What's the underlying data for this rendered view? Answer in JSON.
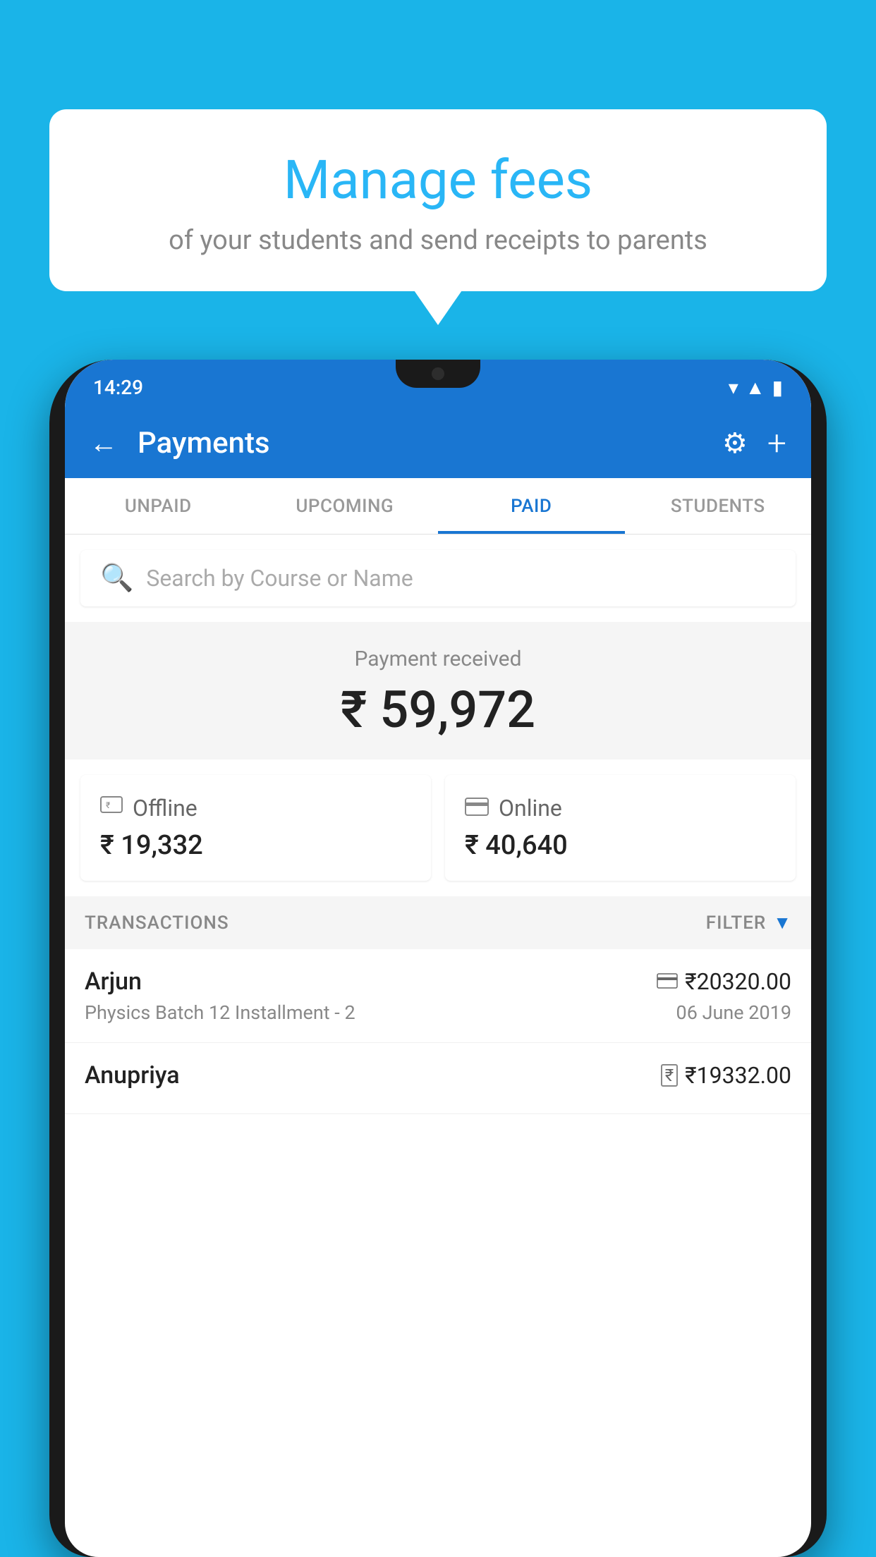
{
  "background_color": "#1ab4e8",
  "speech_bubble": {
    "title": "Manage fees",
    "subtitle": "of your students and send receipts to parents"
  },
  "status_bar": {
    "time": "14:29",
    "wifi": "▼",
    "signal": "▲",
    "battery": "▮"
  },
  "header": {
    "title": "Payments",
    "back_label": "←",
    "plus_label": "+",
    "gear_label": "⚙"
  },
  "tabs": [
    {
      "id": "unpaid",
      "label": "UNPAID",
      "active": false
    },
    {
      "id": "upcoming",
      "label": "UPCOMING",
      "active": false
    },
    {
      "id": "paid",
      "label": "PAID",
      "active": true
    },
    {
      "id": "students",
      "label": "STUDENTS",
      "active": false
    }
  ],
  "search": {
    "placeholder": "Search by Course or Name"
  },
  "payment_received": {
    "label": "Payment received",
    "amount": "₹ 59,972"
  },
  "payment_cards": {
    "offline": {
      "label": "Offline",
      "amount": "₹ 19,332"
    },
    "online": {
      "label": "Online",
      "amount": "₹ 40,640"
    }
  },
  "transactions_header": {
    "label": "TRANSACTIONS",
    "filter_label": "FILTER"
  },
  "transactions": [
    {
      "name": "Arjun",
      "amount": "₹20320.00",
      "course": "Physics Batch 12 Installment - 2",
      "date": "06 June 2019",
      "payment_type": "card"
    },
    {
      "name": "Anupriya",
      "amount": "₹19332.00",
      "course": "",
      "date": "",
      "payment_type": "cash"
    }
  ]
}
